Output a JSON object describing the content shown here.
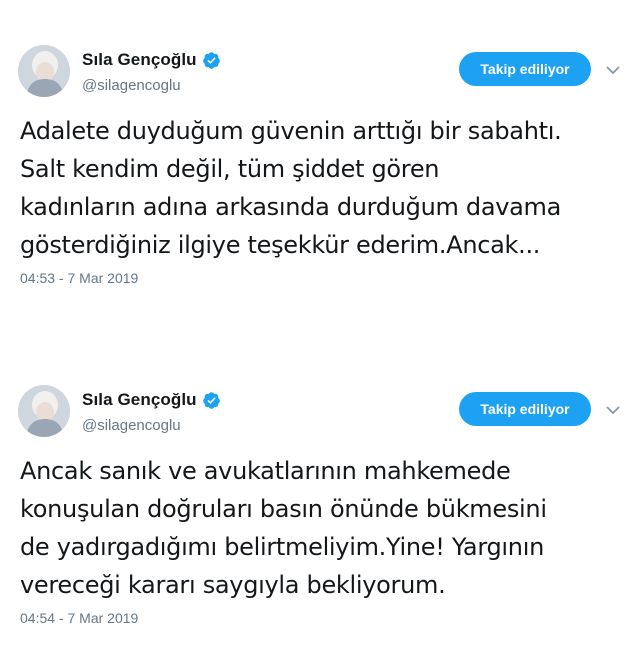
{
  "tweets": [
    {
      "user": {
        "name": "Sıla Gençoğlu",
        "handle": "@silagencoglu",
        "verified": true
      },
      "follow_label": "Takip ediliyor",
      "lines": [
        "Adalete duyduğum güvenin arttığı bir sabahtı.",
        "Salt kendim değil, tüm şiddet gören",
        "kadınların adına arkasında durduğum davama",
        "gösterdiğiniz ilgiye teşekkür ederim.Ancak..."
      ],
      "timestamp": "04:53 - 7 Mar 2019"
    },
    {
      "user": {
        "name": "Sıla Gençoğlu",
        "handle": "@silagencoglu",
        "verified": true
      },
      "follow_label": "Takip ediliyor",
      "lines": [
        "Ancak sanık ve avukatlarının mahkemede",
        "konuşulan doğruları basın önünde bükmesini",
        "de yadırgadığımı belirtmeliyim.Yine! Yargının",
        "vereceği kararı saygıyla bekliyorum."
      ],
      "timestamp": "04:54 - 7 Mar 2019"
    }
  ],
  "colors": {
    "accent": "#1da1f2",
    "secondary_text": "#657786",
    "primary_text": "#14171a"
  },
  "icons": {
    "verified": "verified-badge-icon",
    "caret": "chevron-down-icon"
  }
}
